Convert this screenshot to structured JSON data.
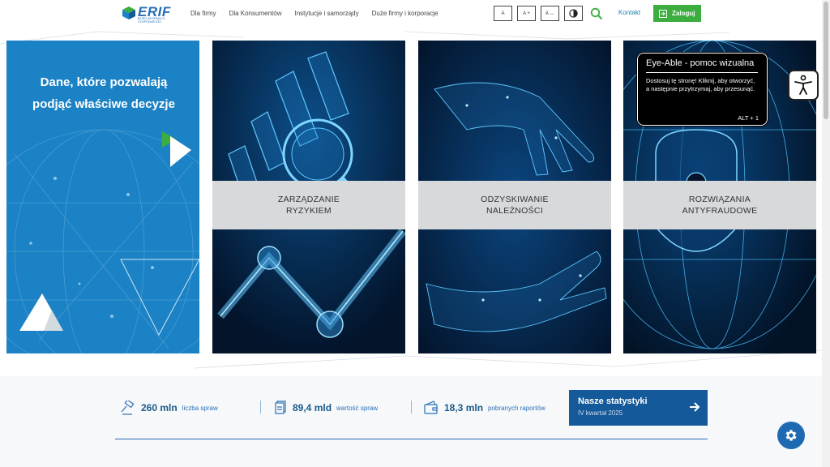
{
  "header": {
    "logo_text": "ERIF",
    "logo_sub": "BIURO INFORMACJI GOSPODARCZEJ",
    "nav": [
      "Dla firmy",
      "Dla Konsumentów",
      "Instytucje i samorządy",
      "Duże firmy i korporacje"
    ],
    "a11y": {
      "font_normal": "A",
      "font_larger": "A +",
      "font_spacing": "A ↔"
    },
    "contact": "Kontakt",
    "login": "Zaloguj"
  },
  "hero": {
    "headline": "Dane, które pozwalają podjąć właściwe decyzje",
    "cards": [
      {
        "label_line1": "ZARZĄDZANIE",
        "label_line2": "RYZYKIEM"
      },
      {
        "label_line1": "ODZYSKIWANIE",
        "label_line2": "NALEŻNOŚCI"
      },
      {
        "label_line1": "ROZWIĄZANIA",
        "label_line2": "ANTYFRAUDOWE"
      }
    ]
  },
  "eye_able": {
    "title": "Eye-Able - pomoc wizualna",
    "body": "Dostosuj tę stronę! Kliknij, aby otworzyć, a następnie przytrzymaj, aby przesunąć.",
    "shortcut": "ALT + 1"
  },
  "stats": [
    {
      "value": "260 mln",
      "label": "liczba spraw",
      "icon": "gavel-icon"
    },
    {
      "value": "89,4 mld",
      "label": "wartość spraw",
      "icon": "document-icon"
    },
    {
      "value": "18,3 mln",
      "label": "pobranych raportów",
      "icon": "wallet-icon"
    }
  ],
  "stats_button": {
    "title": "Nasze statystyki",
    "subtitle": "IV kwartał 2025"
  },
  "colors": {
    "brand_blue": "#1b82c5",
    "dark_navy": "#062448",
    "login_green": "#3cae3f",
    "stats_button": "#14599a"
  }
}
